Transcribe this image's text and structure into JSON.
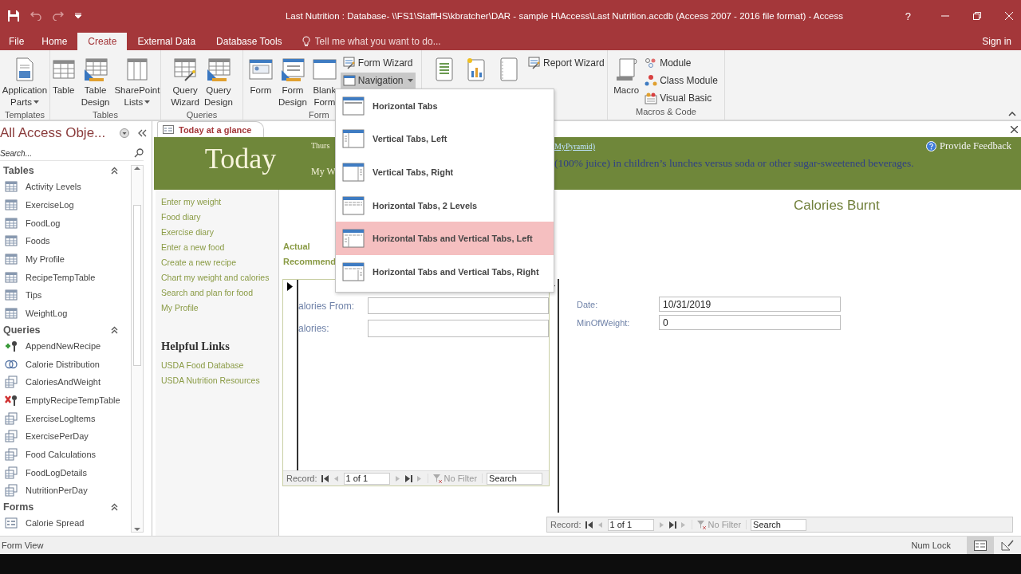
{
  "window": {
    "title": "Last Nutrition : Database- \\\\FS1\\StaffHS\\kbratcher\\DAR - sample H\\Access\\Last Nutrition.accdb (Access 2007 - 2016 file format) - Access",
    "help": "?"
  },
  "menu_tabs": [
    {
      "label": "File",
      "selected": false
    },
    {
      "label": "Home",
      "selected": false
    },
    {
      "label": "Create",
      "selected": true
    },
    {
      "label": "External Data",
      "selected": false
    },
    {
      "label": "Database Tools",
      "selected": false
    }
  ],
  "tell_me": {
    "placeholder": "Tell me what you want to do..."
  },
  "account": "Sign in",
  "ribbon": {
    "groups": [
      {
        "label": "Templates",
        "items": [
          {
            "kind": "large",
            "label": "Application Parts",
            "dropdown": true,
            "expanded": false
          }
        ]
      },
      {
        "label": "Tables",
        "items": [
          {
            "kind": "large",
            "label": "Table",
            "dropdown": false,
            "expanded": false
          },
          {
            "kind": "large",
            "label": "Table Design",
            "dropdown": false,
            "expanded": false
          },
          {
            "kind": "large",
            "label": "SharePoint Lists",
            "dropdown": true,
            "expanded": false
          }
        ]
      },
      {
        "label": "Queries",
        "items": [
          {
            "kind": "large",
            "label": "Query Wizard",
            "dropdown": false,
            "expanded": false
          },
          {
            "kind": "large",
            "label": "Query Design",
            "dropdown": false,
            "expanded": false
          }
        ]
      },
      {
        "label": "Form",
        "items": [
          {
            "kind": "large",
            "label": "Form",
            "dropdown": false,
            "expanded": false
          },
          {
            "kind": "large",
            "label": "Form Design",
            "dropdown": false,
            "expanded": false
          },
          {
            "kind": "large",
            "label": "Blank Form",
            "dropdown": false,
            "expanded": false
          },
          {
            "kind": "small",
            "label": "Form Wizard",
            "dropdown": false,
            "expanded": false
          },
          {
            "kind": "small",
            "label": "Navigation",
            "dropdown": true,
            "expanded": true
          }
        ]
      },
      {
        "items": [
          {
            "kind": "large"
          },
          {
            "kind": "large"
          },
          {
            "kind": "large"
          },
          {
            "kind": "small",
            "label": "Report Wizard",
            "dropdown": false,
            "expanded": false
          }
        ]
      },
      {
        "label": "Macros & Code",
        "items": [
          {
            "kind": "large",
            "label": "Macro",
            "dropdown": false,
            "expanded": false
          },
          {
            "kind": "small",
            "label": "Module",
            "dropdown": false,
            "expanded": false
          },
          {
            "kind": "small",
            "label": "Class Module",
            "dropdown": false,
            "expanded": false
          },
          {
            "kind": "small",
            "label": "Visual Basic",
            "dropdown": false,
            "expanded": false
          }
        ]
      }
    ]
  },
  "navigation_menu": {
    "items": [
      {
        "kind": "horizontal",
        "label": "Horizontal Tabs",
        "selected": false
      },
      {
        "kind": "vertical-left",
        "label": "Vertical Tabs, Left",
        "selected": false
      },
      {
        "kind": "vertical-right",
        "label": "Vertical Tabs, Right",
        "selected": false
      },
      {
        "kind": "horizontal-2",
        "label": "Horizontal Tabs, 2 Levels",
        "selected": false
      },
      {
        "kind": "horizontal-vertical-left",
        "label": "Horizontal Tabs and Vertical Tabs, Left",
        "selected": true
      },
      {
        "kind": "horizontal-vertical-right",
        "label": "Horizontal Tabs and Vertical Tabs, Right",
        "selected": false
      }
    ]
  },
  "nav_pane": {
    "title": "All Access Obje...",
    "search": {
      "placeholder": "Search..."
    },
    "groups": [
      {
        "label": "Tables",
        "expanded": true,
        "items": [
          {
            "kind": "table",
            "label": "Activity Levels"
          },
          {
            "kind": "table",
            "label": "ExerciseLog"
          },
          {
            "kind": "table",
            "label": "FoodLog"
          },
          {
            "kind": "table",
            "label": "Foods"
          },
          {
            "kind": "table",
            "label": "My Profile"
          },
          {
            "kind": "table",
            "label": "RecipeTempTable"
          },
          {
            "kind": "table",
            "label": "Tips"
          },
          {
            "kind": "table",
            "label": "WeightLog"
          }
        ]
      },
      {
        "label": "Queries",
        "expanded": true,
        "items": [
          {
            "kind": "append-query",
            "label": "AppendNewRecipe"
          },
          {
            "kind": "union-query",
            "label": "Calorie Distribution"
          },
          {
            "kind": "select-query",
            "label": "CaloriesAndWeight"
          },
          {
            "kind": "delete-query",
            "label": "EmptyRecipeTempTable"
          },
          {
            "kind": "select-query",
            "label": "ExerciseLogItems"
          },
          {
            "kind": "select-query",
            "label": "ExercisePerDay"
          },
          {
            "kind": "select-query",
            "label": "Food Calculations"
          },
          {
            "kind": "select-query",
            "label": "FoodLogDetails"
          },
          {
            "kind": "select-query",
            "label": "NutritionPerDay"
          }
        ]
      },
      {
        "label": "Forms",
        "expanded": true,
        "items": [
          {
            "kind": "form",
            "label": "Calorie Spread"
          }
        ]
      }
    ]
  },
  "document_tab": {
    "label": "Today at a glance",
    "selected": true
  },
  "header": {
    "title": "Today",
    "date_line": "Thurs",
    "weight_line": "My W",
    "link": "MyPyramid)",
    "tip": "(100% juice) in children’s lunches versus soda or other sugar-sweetened beverages.",
    "feedback": "Provide Feedback"
  },
  "links": [
    "Enter my weight",
    "Food diary",
    "Exercise diary",
    "Enter a new food",
    "Create a new recipe",
    "Chart my weight and calories",
    "Search and plan for food",
    "My Profile"
  ],
  "helpful_links": {
    "title": "Helpful Links",
    "items": [
      "USDA Food Database",
      "USDA Nutrition Resources"
    ]
  },
  "summary_labels": [
    "Actual",
    "Recommend"
  ],
  "left_subform": {
    "fields": [
      {
        "label": "alories From:"
      },
      {
        "label": "alories:"
      }
    ],
    "navigation": {
      "record_label": "Record:",
      "position": "1 of 1",
      "filter": "No Filter",
      "search_placeholder": "Search"
    }
  },
  "chart_title": "Calories Burnt",
  "right_subform": {
    "fields": [
      {
        "label": "Date:",
        "value": "10/31/2019"
      },
      {
        "label": "MinOfWeight:",
        "value": "0"
      }
    ],
    "navigation": {
      "record_label": "Record:",
      "position": "1 of 1",
      "filter": "No Filter",
      "search_placeholder": "Search"
    }
  },
  "status_bar": {
    "view": "Form View",
    "indicator": "Num Lock"
  }
}
